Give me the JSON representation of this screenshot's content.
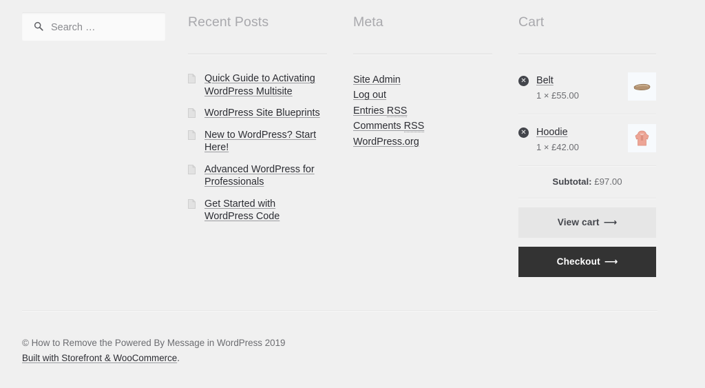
{
  "page": {
    "background_color": "#f0f0f0",
    "text_color": "#43454b"
  },
  "search": {
    "icon": "search-icon",
    "placeholder": "Search …",
    "value": ""
  },
  "recent_posts": {
    "title": "Recent Posts",
    "item_icon": "document-icon",
    "items": [
      {
        "label": "Quick Guide to Activating WordPress Multisite"
      },
      {
        "label": "WordPress Site Blueprints"
      },
      {
        "label": "New to WordPress? Start Here!"
      },
      {
        "label": "Advanced WordPress for Professionals"
      },
      {
        "label": "Get Started with WordPress Code"
      }
    ]
  },
  "meta": {
    "title": "Meta",
    "items": [
      {
        "label": "Site Admin",
        "abbr": ""
      },
      {
        "label": "Log out",
        "abbr": ""
      },
      {
        "label": "Entries ",
        "abbr": "RSS"
      },
      {
        "label": "Comments ",
        "abbr": "RSS"
      },
      {
        "label": "WordPress.org",
        "abbr": ""
      }
    ]
  },
  "cart": {
    "title": "Cart",
    "remove_icon_glyph": "✕",
    "items": [
      {
        "name": "Belt",
        "quantity_price": "1 × £55.00",
        "thumb_name": "belt-thumbnail",
        "thumb_color": "#b08d63"
      },
      {
        "name": "Hoodie",
        "quantity_price": "1 × £42.00",
        "thumb_name": "hoodie-thumbnail",
        "thumb_color": "#f0a193"
      }
    ],
    "subtotal_label": "Subtotal:",
    "subtotal_value": "£97.00",
    "view_cart_label": "View cart",
    "checkout_label": "Checkout",
    "arrow_glyph": "⟶",
    "primary_button_color": "#333333",
    "secondary_button_color": "#e6e6e6"
  },
  "footer": {
    "copyright": "© How to Remove the Powered By Message in WordPress 2019",
    "built_with": "Built with Storefront & WooCommerce",
    "built_with_suffix": "."
  }
}
